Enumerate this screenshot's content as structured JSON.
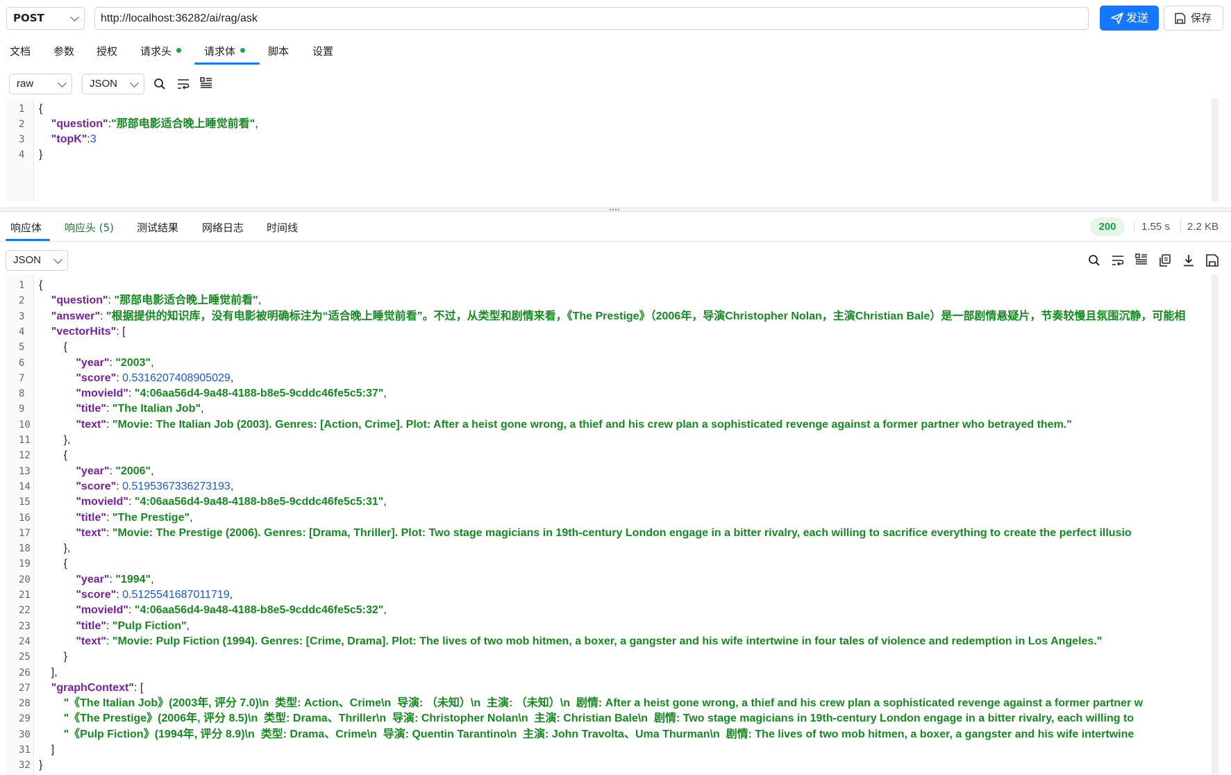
{
  "request": {
    "method": "POST",
    "url": "http://localhost:36282/ai/rag/ask",
    "send_label": "发送",
    "save_label": "保存"
  },
  "request_tabs": [
    {
      "label": "文档"
    },
    {
      "label": "参数"
    },
    {
      "label": "授权"
    },
    {
      "label": "请求头",
      "dot": true
    },
    {
      "label": "请求体",
      "dot": true,
      "active": true
    },
    {
      "label": "脚本"
    },
    {
      "label": "设置"
    }
  ],
  "body_mode": "raw",
  "body_format": "JSON",
  "request_body_lines": [
    [
      [
        "p",
        "{"
      ]
    ],
    [
      [
        "p",
        "    "
      ],
      [
        "k",
        "\"question\""
      ],
      [
        "p",
        ":"
      ],
      [
        "s",
        "\"那部电影适合晚上睡觉前看\""
      ],
      [
        "p",
        ","
      ]
    ],
    [
      [
        "p",
        "    "
      ],
      [
        "k",
        "\"topK\""
      ],
      [
        "p",
        ":"
      ],
      [
        "n",
        "3"
      ]
    ],
    [
      [
        "p",
        "}"
      ]
    ]
  ],
  "response_tabs": [
    {
      "label": "响应体",
      "active": true
    },
    {
      "label": "响应头 (5)",
      "count": true
    },
    {
      "label": "测试结果"
    },
    {
      "label": "网络日志"
    },
    {
      "label": "时间线"
    }
  ],
  "response_meta": {
    "status": "200",
    "time": "1.55 s",
    "size": "2.2 KB"
  },
  "response_format": "JSON",
  "response_body_lines": [
    [
      [
        "p",
        "{"
      ]
    ],
    [
      [
        "p",
        "    "
      ],
      [
        "k",
        "\"question\""
      ],
      [
        "p",
        ": "
      ],
      [
        "s",
        "\"那部电影适合晚上睡觉前看\""
      ],
      [
        "p",
        ","
      ]
    ],
    [
      [
        "p",
        "    "
      ],
      [
        "k",
        "\"answer\""
      ],
      [
        "p",
        ": "
      ],
      [
        "s",
        "\"根据提供的知识库，没有电影被明确标注为“适合晚上睡觉前看”。不过，从类型和剧情来看，《The Prestige》（2006年，导演Christopher Nolan，主演Christian Bale）是一部剧情悬疑片，节奏较慢且氛围沉静，可能相"
      ]
    ],
    [
      [
        "p",
        "    "
      ],
      [
        "k",
        "\"vectorHits\""
      ],
      [
        "p",
        ": ["
      ]
    ],
    [
      [
        "p",
        "        {"
      ]
    ],
    [
      [
        "p",
        "            "
      ],
      [
        "k",
        "\"year\""
      ],
      [
        "p",
        ": "
      ],
      [
        "s",
        "\"2003\""
      ],
      [
        "p",
        ","
      ]
    ],
    [
      [
        "p",
        "            "
      ],
      [
        "k",
        "\"score\""
      ],
      [
        "p",
        ": "
      ],
      [
        "n",
        "0.5316207408905029"
      ],
      [
        "p",
        ","
      ]
    ],
    [
      [
        "p",
        "            "
      ],
      [
        "k",
        "\"movieId\""
      ],
      [
        "p",
        ": "
      ],
      [
        "s",
        "\"4:06aa56d4-9a48-4188-b8e5-9cddc46fe5c5:37\""
      ],
      [
        "p",
        ","
      ]
    ],
    [
      [
        "p",
        "            "
      ],
      [
        "k",
        "\"title\""
      ],
      [
        "p",
        ": "
      ],
      [
        "s",
        "\"The Italian Job\""
      ],
      [
        "p",
        ","
      ]
    ],
    [
      [
        "p",
        "            "
      ],
      [
        "k",
        "\"text\""
      ],
      [
        "p",
        ": "
      ],
      [
        "s",
        "\"Movie: The Italian Job (2003). Genres: [Action, Crime]. Plot: After a heist gone wrong, a thief and his crew plan a sophisticated revenge against a former partner who betrayed them.\""
      ]
    ],
    [
      [
        "p",
        "        },"
      ]
    ],
    [
      [
        "p",
        "        {"
      ]
    ],
    [
      [
        "p",
        "            "
      ],
      [
        "k",
        "\"year\""
      ],
      [
        "p",
        ": "
      ],
      [
        "s",
        "\"2006\""
      ],
      [
        "p",
        ","
      ]
    ],
    [
      [
        "p",
        "            "
      ],
      [
        "k",
        "\"score\""
      ],
      [
        "p",
        ": "
      ],
      [
        "n",
        "0.5195367336273193"
      ],
      [
        "p",
        ","
      ]
    ],
    [
      [
        "p",
        "            "
      ],
      [
        "k",
        "\"movieId\""
      ],
      [
        "p",
        ": "
      ],
      [
        "s",
        "\"4:06aa56d4-9a48-4188-b8e5-9cddc46fe5c5:31\""
      ],
      [
        "p",
        ","
      ]
    ],
    [
      [
        "p",
        "            "
      ],
      [
        "k",
        "\"title\""
      ],
      [
        "p",
        ": "
      ],
      [
        "s",
        "\"The Prestige\""
      ],
      [
        "p",
        ","
      ]
    ],
    [
      [
        "p",
        "            "
      ],
      [
        "k",
        "\"text\""
      ],
      [
        "p",
        ": "
      ],
      [
        "s",
        "\"Movie: The Prestige (2006). Genres: [Drama, Thriller]. Plot: Two stage magicians in 19th-century London engage in a bitter rivalry, each willing to sacrifice everything to create the perfect illusio"
      ]
    ],
    [
      [
        "p",
        "        },"
      ]
    ],
    [
      [
        "p",
        "        {"
      ]
    ],
    [
      [
        "p",
        "            "
      ],
      [
        "k",
        "\"year\""
      ],
      [
        "p",
        ": "
      ],
      [
        "s",
        "\"1994\""
      ],
      [
        "p",
        ","
      ]
    ],
    [
      [
        "p",
        "            "
      ],
      [
        "k",
        "\"score\""
      ],
      [
        "p",
        ": "
      ],
      [
        "n",
        "0.5125541687011719"
      ],
      [
        "p",
        ","
      ]
    ],
    [
      [
        "p",
        "            "
      ],
      [
        "k",
        "\"movieId\""
      ],
      [
        "p",
        ": "
      ],
      [
        "s",
        "\"4:06aa56d4-9a48-4188-b8e5-9cddc46fe5c5:32\""
      ],
      [
        "p",
        ","
      ]
    ],
    [
      [
        "p",
        "            "
      ],
      [
        "k",
        "\"title\""
      ],
      [
        "p",
        ": "
      ],
      [
        "s",
        "\"Pulp Fiction\""
      ],
      [
        "p",
        ","
      ]
    ],
    [
      [
        "p",
        "            "
      ],
      [
        "k",
        "\"text\""
      ],
      [
        "p",
        ": "
      ],
      [
        "s",
        "\"Movie: Pulp Fiction (1994). Genres: [Crime, Drama]. Plot: The lives of two mob hitmen, a boxer, a gangster and his wife intertwine in four tales of violence and redemption in Los Angeles.\""
      ]
    ],
    [
      [
        "p",
        "        }"
      ]
    ],
    [
      [
        "p",
        "    ],"
      ]
    ],
    [
      [
        "p",
        "    "
      ],
      [
        "k",
        "\"graphContext\""
      ],
      [
        "p",
        ": ["
      ]
    ],
    [
      [
        "p",
        "        "
      ],
      [
        "s",
        "\"《The Italian Job》(2003年, 评分 7.0)\\n  类型: Action、Crime\\n  导演: （未知）\\n  主演: （未知）\\n  剧情: After a heist gone wrong, a thief and his crew plan a sophisticated revenge against a former partner w"
      ]
    ],
    [
      [
        "p",
        "        "
      ],
      [
        "s",
        "\"《The Prestige》(2006年, 评分 8.5)\\n  类型: Drama、Thriller\\n  导演: Christopher Nolan\\n  主演: Christian Bale\\n  剧情: Two stage magicians in 19th-century London engage in a bitter rivalry, each willing to"
      ]
    ],
    [
      [
        "p",
        "        "
      ],
      [
        "s",
        "\"《Pulp Fiction》(1994年, 评分 8.9)\\n  类型: Drama、Crime\\n  导演: Quentin Tarantino\\n  主演: John Travolta、Uma Thurman\\n  剧情: The lives of two mob hitmen, a boxer, a gangster and his wife intertwine"
      ]
    ],
    [
      [
        "p",
        "    ]"
      ]
    ],
    [
      [
        "p",
        "}"
      ]
    ]
  ],
  "colors": {
    "accent": "#1677ff",
    "key": "#7a1fa2",
    "string": "#148a1f",
    "number": "#1b57d6",
    "status_ok": "#1e9c43"
  }
}
